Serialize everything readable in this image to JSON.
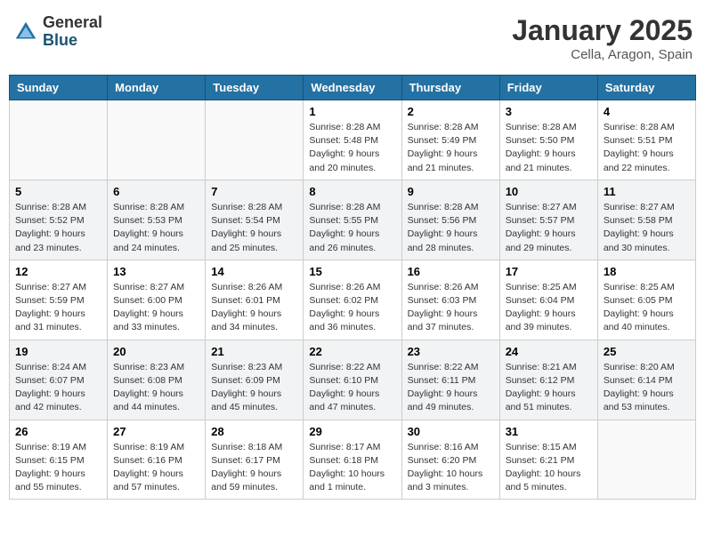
{
  "header": {
    "logo_general": "General",
    "logo_blue": "Blue",
    "month_title": "January 2025",
    "location": "Cella, Aragon, Spain"
  },
  "weekdays": [
    "Sunday",
    "Monday",
    "Tuesday",
    "Wednesday",
    "Thursday",
    "Friday",
    "Saturday"
  ],
  "weeks": [
    [
      {
        "day": "",
        "info": ""
      },
      {
        "day": "",
        "info": ""
      },
      {
        "day": "",
        "info": ""
      },
      {
        "day": "1",
        "info": "Sunrise: 8:28 AM\nSunset: 5:48 PM\nDaylight: 9 hours\nand 20 minutes."
      },
      {
        "day": "2",
        "info": "Sunrise: 8:28 AM\nSunset: 5:49 PM\nDaylight: 9 hours\nand 21 minutes."
      },
      {
        "day": "3",
        "info": "Sunrise: 8:28 AM\nSunset: 5:50 PM\nDaylight: 9 hours\nand 21 minutes."
      },
      {
        "day": "4",
        "info": "Sunrise: 8:28 AM\nSunset: 5:51 PM\nDaylight: 9 hours\nand 22 minutes."
      }
    ],
    [
      {
        "day": "5",
        "info": "Sunrise: 8:28 AM\nSunset: 5:52 PM\nDaylight: 9 hours\nand 23 minutes."
      },
      {
        "day": "6",
        "info": "Sunrise: 8:28 AM\nSunset: 5:53 PM\nDaylight: 9 hours\nand 24 minutes."
      },
      {
        "day": "7",
        "info": "Sunrise: 8:28 AM\nSunset: 5:54 PM\nDaylight: 9 hours\nand 25 minutes."
      },
      {
        "day": "8",
        "info": "Sunrise: 8:28 AM\nSunset: 5:55 PM\nDaylight: 9 hours\nand 26 minutes."
      },
      {
        "day": "9",
        "info": "Sunrise: 8:28 AM\nSunset: 5:56 PM\nDaylight: 9 hours\nand 28 minutes."
      },
      {
        "day": "10",
        "info": "Sunrise: 8:27 AM\nSunset: 5:57 PM\nDaylight: 9 hours\nand 29 minutes."
      },
      {
        "day": "11",
        "info": "Sunrise: 8:27 AM\nSunset: 5:58 PM\nDaylight: 9 hours\nand 30 minutes."
      }
    ],
    [
      {
        "day": "12",
        "info": "Sunrise: 8:27 AM\nSunset: 5:59 PM\nDaylight: 9 hours\nand 31 minutes."
      },
      {
        "day": "13",
        "info": "Sunrise: 8:27 AM\nSunset: 6:00 PM\nDaylight: 9 hours\nand 33 minutes."
      },
      {
        "day": "14",
        "info": "Sunrise: 8:26 AM\nSunset: 6:01 PM\nDaylight: 9 hours\nand 34 minutes."
      },
      {
        "day": "15",
        "info": "Sunrise: 8:26 AM\nSunset: 6:02 PM\nDaylight: 9 hours\nand 36 minutes."
      },
      {
        "day": "16",
        "info": "Sunrise: 8:26 AM\nSunset: 6:03 PM\nDaylight: 9 hours\nand 37 minutes."
      },
      {
        "day": "17",
        "info": "Sunrise: 8:25 AM\nSunset: 6:04 PM\nDaylight: 9 hours\nand 39 minutes."
      },
      {
        "day": "18",
        "info": "Sunrise: 8:25 AM\nSunset: 6:05 PM\nDaylight: 9 hours\nand 40 minutes."
      }
    ],
    [
      {
        "day": "19",
        "info": "Sunrise: 8:24 AM\nSunset: 6:07 PM\nDaylight: 9 hours\nand 42 minutes."
      },
      {
        "day": "20",
        "info": "Sunrise: 8:23 AM\nSunset: 6:08 PM\nDaylight: 9 hours\nand 44 minutes."
      },
      {
        "day": "21",
        "info": "Sunrise: 8:23 AM\nSunset: 6:09 PM\nDaylight: 9 hours\nand 45 minutes."
      },
      {
        "day": "22",
        "info": "Sunrise: 8:22 AM\nSunset: 6:10 PM\nDaylight: 9 hours\nand 47 minutes."
      },
      {
        "day": "23",
        "info": "Sunrise: 8:22 AM\nSunset: 6:11 PM\nDaylight: 9 hours\nand 49 minutes."
      },
      {
        "day": "24",
        "info": "Sunrise: 8:21 AM\nSunset: 6:12 PM\nDaylight: 9 hours\nand 51 minutes."
      },
      {
        "day": "25",
        "info": "Sunrise: 8:20 AM\nSunset: 6:14 PM\nDaylight: 9 hours\nand 53 minutes."
      }
    ],
    [
      {
        "day": "26",
        "info": "Sunrise: 8:19 AM\nSunset: 6:15 PM\nDaylight: 9 hours\nand 55 minutes."
      },
      {
        "day": "27",
        "info": "Sunrise: 8:19 AM\nSunset: 6:16 PM\nDaylight: 9 hours\nand 57 minutes."
      },
      {
        "day": "28",
        "info": "Sunrise: 8:18 AM\nSunset: 6:17 PM\nDaylight: 9 hours\nand 59 minutes."
      },
      {
        "day": "29",
        "info": "Sunrise: 8:17 AM\nSunset: 6:18 PM\nDaylight: 10 hours\nand 1 minute."
      },
      {
        "day": "30",
        "info": "Sunrise: 8:16 AM\nSunset: 6:20 PM\nDaylight: 10 hours\nand 3 minutes."
      },
      {
        "day": "31",
        "info": "Sunrise: 8:15 AM\nSunset: 6:21 PM\nDaylight: 10 hours\nand 5 minutes."
      },
      {
        "day": "",
        "info": ""
      }
    ]
  ]
}
